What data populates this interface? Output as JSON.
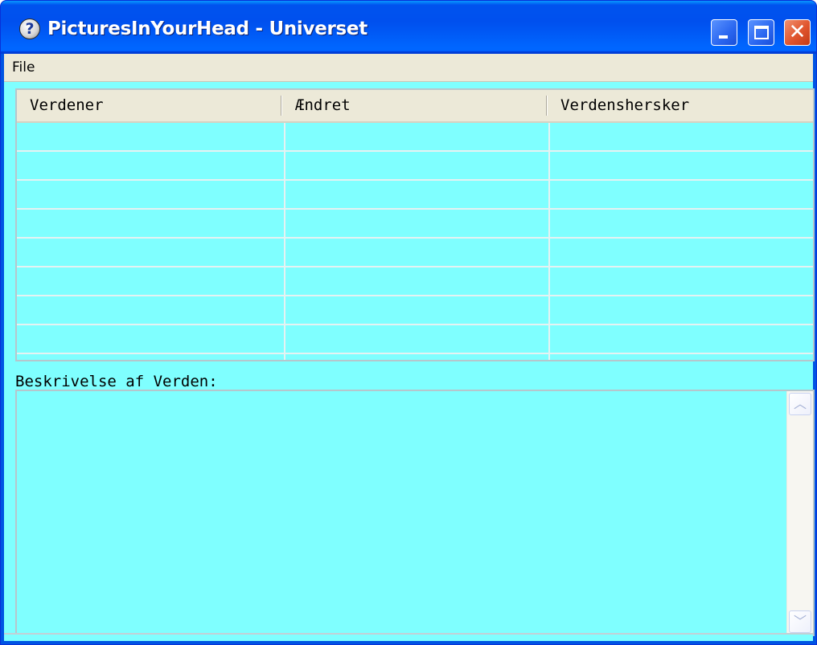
{
  "window": {
    "title": "PicturesInYourHead - Universet",
    "icon": "help-question-icon",
    "controls": {
      "minimize": "minimize-icon",
      "maximize": "maximize-icon",
      "close": "close-icon",
      "close_glyph": "✕"
    }
  },
  "menubar": {
    "items": [
      {
        "label": "File"
      }
    ]
  },
  "table": {
    "columns": [
      "Verdener",
      "Ændret",
      "Verdenshersker"
    ],
    "rows": []
  },
  "description": {
    "label": "Beskrivelse af Verden:",
    "value": ""
  },
  "colors": {
    "content_background": "#7fffff",
    "titlebar": "#0054e3",
    "menubar": "#ece9d8"
  }
}
